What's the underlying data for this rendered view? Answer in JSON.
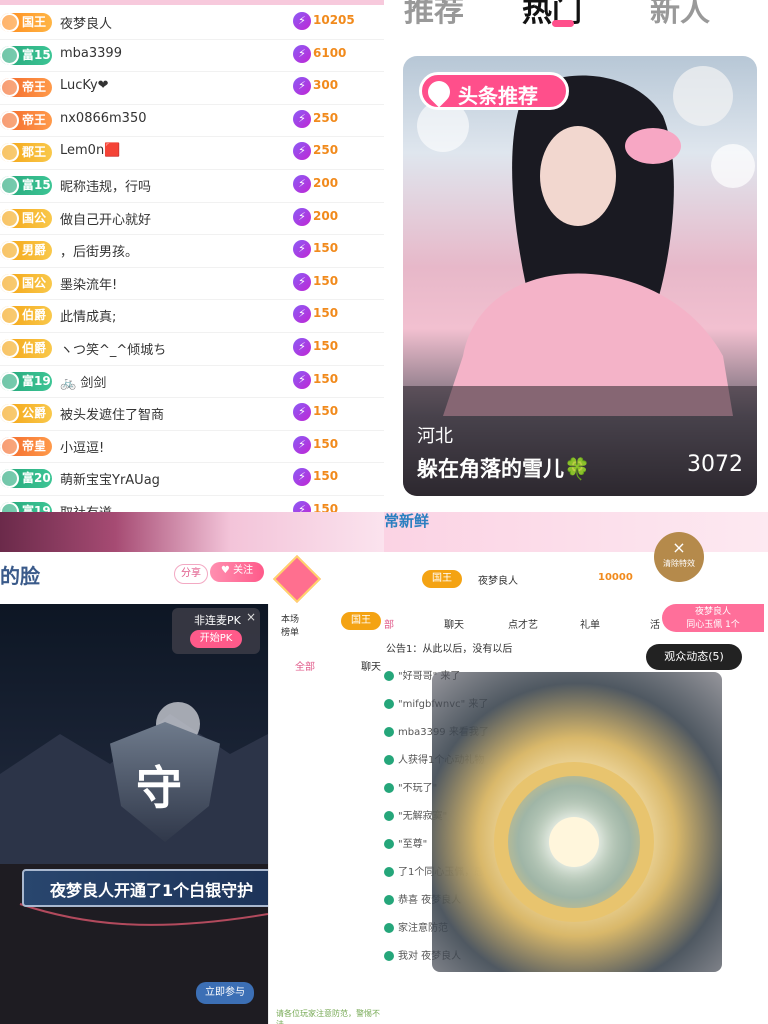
{
  "ranking": [
    {
      "badge": "国王",
      "color": "orange",
      "name": "夜梦良人",
      "score": "10205"
    },
    {
      "badge": "富15",
      "color": "green",
      "name": "mba3399",
      "score": "6100"
    },
    {
      "badge": "帝王",
      "color": "red",
      "name": "LucKy❤",
      "score": "300"
    },
    {
      "badge": "帝王",
      "color": "red",
      "name": "nx0866m350",
      "score": "250"
    },
    {
      "badge": "郡王",
      "color": "gold",
      "name": "Lem0n🟥",
      "score": "250"
    },
    {
      "badge": "富15",
      "color": "green",
      "name": "昵称违规，行吗",
      "score": "200"
    },
    {
      "badge": "国公",
      "color": "gold",
      "name": "做自己开心就好",
      "score": "200"
    },
    {
      "badge": "男爵",
      "color": "gold",
      "name": "，后街男孩。",
      "score": "150"
    },
    {
      "badge": "国公",
      "color": "gold",
      "name": "墨染流年!",
      "score": "150"
    },
    {
      "badge": "伯爵",
      "color": "gold",
      "name": "此情成真;",
      "score": "150"
    },
    {
      "badge": "伯爵",
      "color": "gold",
      "name": "ヽつ笑^_^倾城ち",
      "score": "150"
    },
    {
      "badge": "富19",
      "color": "green",
      "name": "🚲 剑剑",
      "score": "150"
    },
    {
      "badge": "公爵",
      "color": "gold",
      "name": "被头发遮住了智商",
      "score": "150"
    },
    {
      "badge": "帝皇",
      "color": "red",
      "name": "小逗逗!",
      "score": "150"
    },
    {
      "badge": "富20",
      "color": "green",
      "name": "萌新宝宝YrAUag",
      "score": "150"
    },
    {
      "badge": "富19",
      "color": "green",
      "name": "取社有道",
      "score": "150"
    }
  ],
  "hot_page": {
    "tabs": [
      "推荐",
      "热门",
      "新人"
    ],
    "card": {
      "tag": "头条推荐",
      "location": "河北",
      "name": "躲在角落的雪儿🍀",
      "count": "3072"
    }
  },
  "live_left": {
    "title_fragment": "的脸",
    "share_label": "分享",
    "follow_label": "关注",
    "pk_title": "非连麦PK",
    "pk_button": "开始PK",
    "rank_label": "本场榜单",
    "user_badge": "国王",
    "tab_all": "全部",
    "tab_chat": "聊天",
    "banner_text": "夜梦良人开通了1个白银守护",
    "shield_char": "守",
    "join_button": "立即参与",
    "notice": "请各位玩家注意防范，警惕不法"
  },
  "live_right": {
    "top_fragment": "常新鲜",
    "close_label": "清除特效",
    "user_badge": "国王",
    "user_name": "夜梦良人",
    "user_score": "10000",
    "gift_user": "夜梦良人",
    "gift_text": "同心玉佩 1个",
    "tabs": [
      "部",
      "聊天",
      "点才艺",
      "礼单",
      "活"
    ],
    "announcement": "公告1：从此以后，没有以后",
    "audience_label": "观众动态(5)",
    "chat_lines": [
      "\"好哥哥\" 来了",
      "\"mifgbfwnvc\" 来了",
      "mba3399 来看我了",
      "人获得1个心动礼物",
      "\"不玩了\"",
      "\"无解寂寞\"",
      "\"至尊\"",
      "了1个同心玉佩，感",
      "恭喜 夜梦良人",
      "家注意防范",
      "我对 夜梦良人"
    ]
  },
  "colors": {
    "pink": "#ff4f8b",
    "score": "#f18a1c",
    "green": "#25a67a",
    "gold": "#f4a313",
    "orange": "#ff8a1d"
  }
}
